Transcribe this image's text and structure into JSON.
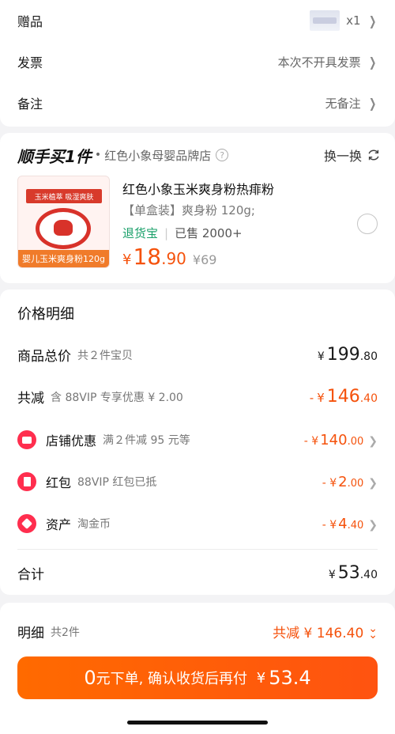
{
  "order_rows": {
    "gift": {
      "label": "赠品",
      "value": "x1"
    },
    "invoice": {
      "label": "发票",
      "value": "本次不开具发票"
    },
    "note": {
      "label": "备注",
      "value": "无备注"
    }
  },
  "shop": {
    "logo": "顺手买1件",
    "dot": "•",
    "name": "红色小象母婴品牌店",
    "info_icon": "?",
    "swap_label": "换一换"
  },
  "product": {
    "title": "红色小象玉米爽身粉热痱粉",
    "spec": "【单盒装】爽身粉 120g;",
    "tag_return": "退货宝",
    "tag_sold": "已售 2000+",
    "currency": "¥",
    "price_int": "18",
    "price_dec": ".90",
    "price_old": "¥69",
    "image_band": "婴儿玉米爽身粉120g",
    "image_strip": "玉米植萃 吸湿爽肤"
  },
  "price_detail": {
    "title": "价格明细",
    "total": {
      "label": "商品总价",
      "sub": "共２件宝贝",
      "yen": "¥",
      "int": "199",
      "dec": ".80"
    },
    "reduce": {
      "label": "共减",
      "sub": "含 88VIP 专享优惠 ¥ 2.00",
      "sign": "-",
      "yen": "¥",
      "int": "146",
      "dec": ".40"
    },
    "shop_discount": {
      "label": "店铺优惠",
      "sub": "满２件减 95 元等",
      "prefix": "- ¥",
      "int": "140",
      "dec": ".00"
    },
    "red_packet": {
      "label": "红包",
      "sub": "88VIP 红包已抵",
      "prefix": "- ¥",
      "int": "2",
      "dec": ".00"
    },
    "assets": {
      "label": "资产",
      "sub": "淘金币",
      "prefix": "- ¥",
      "int": "4",
      "dec": ".40"
    },
    "subtotal": {
      "label": "合计",
      "yen": "¥",
      "int": "53",
      "dec": ".40"
    }
  },
  "footer": {
    "detail_label": "明细",
    "detail_sub": "共2件",
    "saving": "共减 ¥ 146.40",
    "cta_zero": "0",
    "cta_text": "元下单, 确认收货后再付 ",
    "cta_yen": "¥",
    "cta_amount": "53.4"
  },
  "colors": {
    "accent": "#f5520c",
    "green": "#1aa06a",
    "red_icon": "#ff2e4e"
  }
}
